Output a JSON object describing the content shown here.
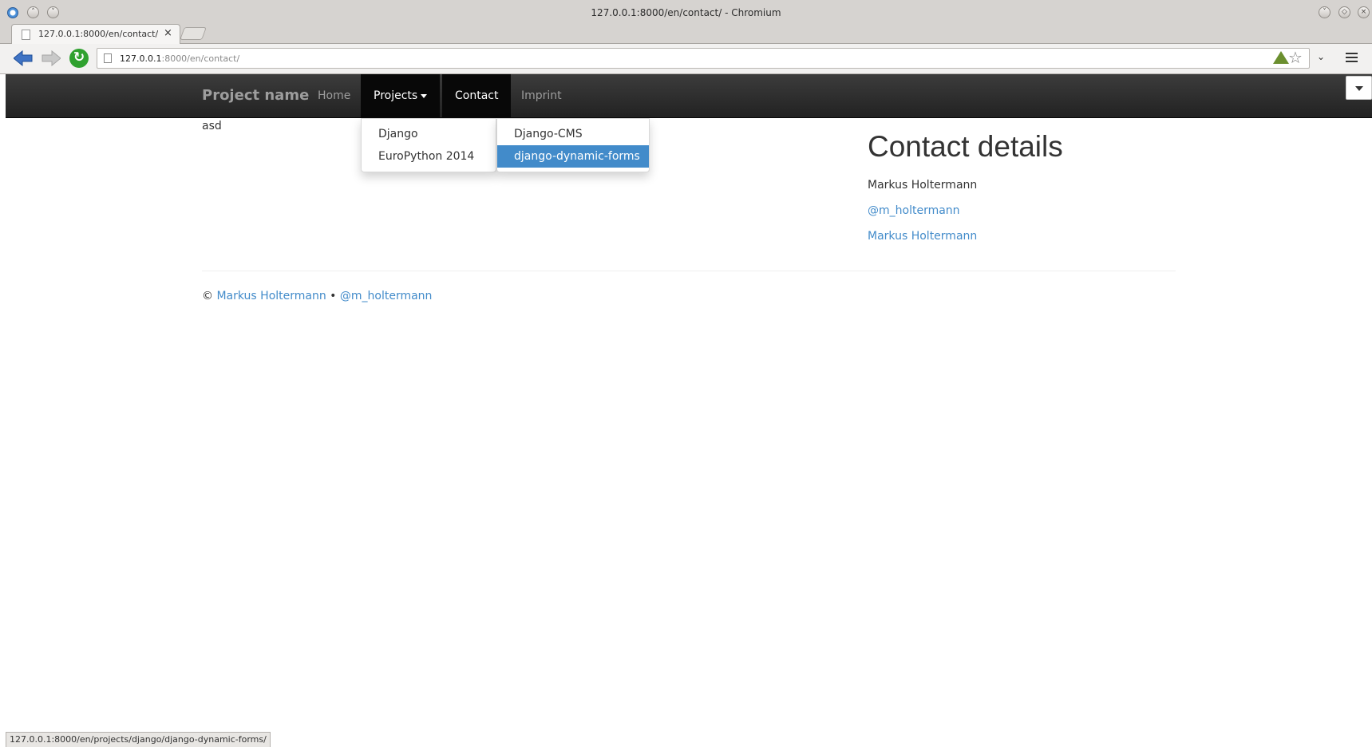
{
  "window": {
    "title": "127.0.0.1:8000/en/contact/ - Chromium"
  },
  "tabs": [
    {
      "title": "127.0.0.1:8000/en/contact/"
    }
  ],
  "toolbar": {
    "url_host": "127.0.0.1",
    "url_path": ":8000/en/contact/",
    "icons": [
      "back-icon",
      "forward-icon",
      "reload-icon",
      "page-icon",
      "extension-icon",
      "bookmark-star-icon",
      "chevron-down-icon",
      "hamburger-menu-icon"
    ]
  },
  "navbar": {
    "brand": "Project name",
    "items": [
      {
        "label": "Home"
      },
      {
        "label": "Projects"
      },
      {
        "label": "Contact"
      },
      {
        "label": "Imprint"
      }
    ]
  },
  "projects_menu": {
    "items": [
      {
        "label": "Django"
      },
      {
        "label": "EuroPython 2014"
      }
    ]
  },
  "django_submenu": {
    "items": [
      {
        "label": "Django-CMS"
      },
      {
        "label": "django-dynamic-forms"
      }
    ]
  },
  "main": {
    "text": "asd"
  },
  "contact": {
    "heading": "Contact details",
    "name": "Markus Holtermann",
    "twitter": "@m_holtermann",
    "website": "Markus Holtermann"
  },
  "footer": {
    "copyright": "©",
    "name_link": "Markus Holtermann",
    "separator": "•",
    "twitter_link": "@m_holtermann"
  },
  "status": {
    "hover_url": "127.0.0.1:8000/en/projects/django/django-dynamic-forms/"
  },
  "colors": {
    "link": "#428bca",
    "highlight": "#428bca",
    "navbar": "#222222"
  }
}
